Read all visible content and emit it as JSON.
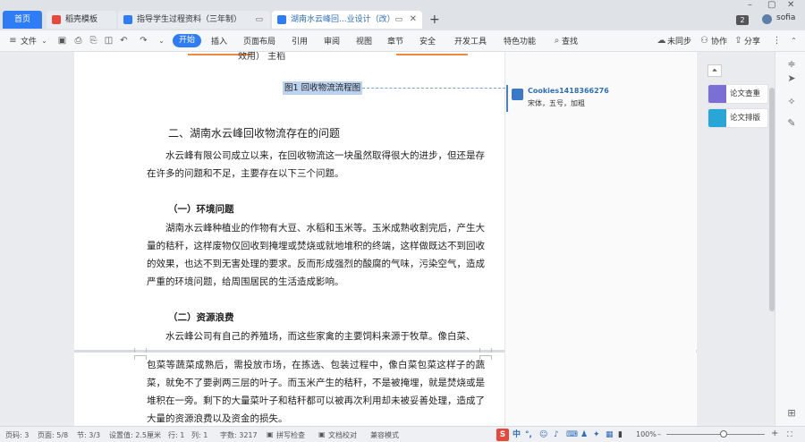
{
  "tabs": {
    "home": "首页",
    "items": [
      {
        "label": "稻壳模板",
        "color": "#e8483c"
      },
      {
        "label": "指导学生过程资料（三年制）",
        "color": "#2f7df6"
      },
      {
        "label": "湖南水云峰回...业设计（改）",
        "color": "#2f7df6"
      }
    ],
    "new_tab": "+",
    "window_count": "2",
    "user": "sofia"
  },
  "menu": {
    "file": "文件",
    "items": [
      "开始",
      "插入",
      "页面布局",
      "引用",
      "审阅",
      "视图",
      "章节",
      "安全",
      "开发工具",
      "特色功能"
    ],
    "search": "查找",
    "sync": "未同步",
    "collab": "协作",
    "share": "分享"
  },
  "document": {
    "top_fragment": "效用）   主稻",
    "caption": "图1 回收物流流程图",
    "section2_title": "二、湖南水云峰回收物流存在的问题",
    "intro": "水云峰有限公司成立以来，在回收物流这一块虽然取得很大的进步，但还是存在许多的问题和不足，主要存在以下三个问题。",
    "env_title": "（一）环境问题",
    "env_text": "湖南水云峰种植业的作物有大豆、水稻和玉米等。玉米成熟收割完后，产生大量的秸秆，这样废物仅回收到掩埋或焚烧或就地堆积的终端，这样做既达不到回收的效果，也达不到无害处理的要求。反而形成强烈的酸腐的气味，污染空气，造成严重的环境问题，给周围居民的生活造成影响。",
    "waste_title": "（二）资源浪费",
    "waste_text_p1": "水云峰公司有自己的养殖场，而这些家禽的主要饲料来源于牧草。像白菜、",
    "waste_text_p2": "包菜等蔬菜成熟后，需投放市场，在拣选、包装过程中，像白菜包菜这样子的蔬菜，就免不了要剥两三层的叶子。而玉米产生的秸秆，不是被掩埋，就是焚烧或是堆积在一旁。剩下的大量菜叶子和秸秆都可以被再次利用却未被妥善处理，造成了大量的资源浪费以及资金的损失。"
  },
  "comment": {
    "user": "Cookies1418366276",
    "text": "宋体，五号，加粗"
  },
  "side_tools": [
    {
      "label": "论文查重",
      "color": "#7b6fd6"
    },
    {
      "label": "论文排版",
      "color": "#2aa6d6"
    }
  ],
  "status": {
    "page_num": "页码: 3",
    "pages": "页面: 5/8",
    "section": "节: 3/3",
    "setting": "设置值: 2.5厘米",
    "row": "行: 1",
    "col": "列: 1",
    "words": "字数: 3217",
    "spell": "拼写检查",
    "proof": "文档校对",
    "compat": "兼容模式",
    "zoom": "100%",
    "ime_cn": "中"
  }
}
